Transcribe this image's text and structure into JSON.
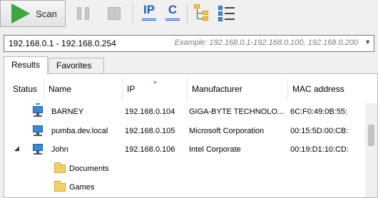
{
  "toolbar": {
    "scan_label": "Scan",
    "icons": [
      "play-icon",
      "pause-icon",
      "stop-icon",
      "ip-icon",
      "c-icon",
      "tree-view-icon",
      "list-view-icon"
    ],
    "ip_letter": "IP",
    "c_letter": "C"
  },
  "range": {
    "value": "192.168.0.1 - 192.168.0.254",
    "hint": "Example: 192.168.0.1-192.168.0.100, 192.168.0.200"
  },
  "tabs": [
    {
      "label": "Results",
      "active": true
    },
    {
      "label": "Favorites",
      "active": false
    }
  ],
  "columns": [
    "Status",
    "Name",
    "IP",
    "Manufacturer",
    "MAC address"
  ],
  "rows": [
    {
      "name": "BARNEY",
      "ip": "192.168.0.104",
      "manufacturer": "GIGA-BYTE TECHNOLO...",
      "mac": "6C:F0:49:0B:55:"
    },
    {
      "name": "pumba.dev.local",
      "ip": "192.168.0.105",
      "manufacturer": "Microsoft Corporation",
      "mac": "00:15:5D:00:CB:"
    },
    {
      "name": "John",
      "ip": "192.168.0.106",
      "manufacturer": "Intel Corporate",
      "mac": "00:19:D1:10:CD:",
      "expanded": true
    }
  ],
  "folders": [
    "Documents",
    "Games"
  ]
}
